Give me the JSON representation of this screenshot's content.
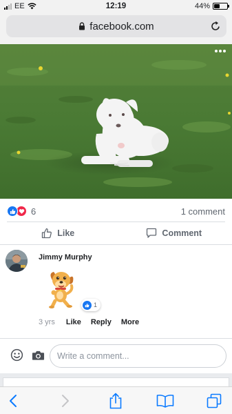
{
  "status_bar": {
    "carrier": "EE",
    "time": "12:19",
    "battery": "44%",
    "battery_level": 0.44
  },
  "browser": {
    "url": "facebook.com"
  },
  "post": {
    "photo_subject": "white dog lying on grass",
    "reaction_count": "6",
    "reactions": [
      "like",
      "love"
    ],
    "comment_count": "1 comment",
    "actions": {
      "like_label": "Like",
      "comment_label": "Comment"
    }
  },
  "comment": {
    "author": "Jimmy Murphy",
    "sticker": "cartoon dog sticker",
    "reaction_count": "1",
    "age": "3 yrs",
    "like_label": "Like",
    "reply_label": "Reply",
    "more_label": "More"
  },
  "composer": {
    "placeholder": "Write a comment..."
  },
  "colors": {
    "facebook_blue": "#1877f2",
    "love_red": "#f0284a",
    "ios_blue": "#0a7aff"
  }
}
